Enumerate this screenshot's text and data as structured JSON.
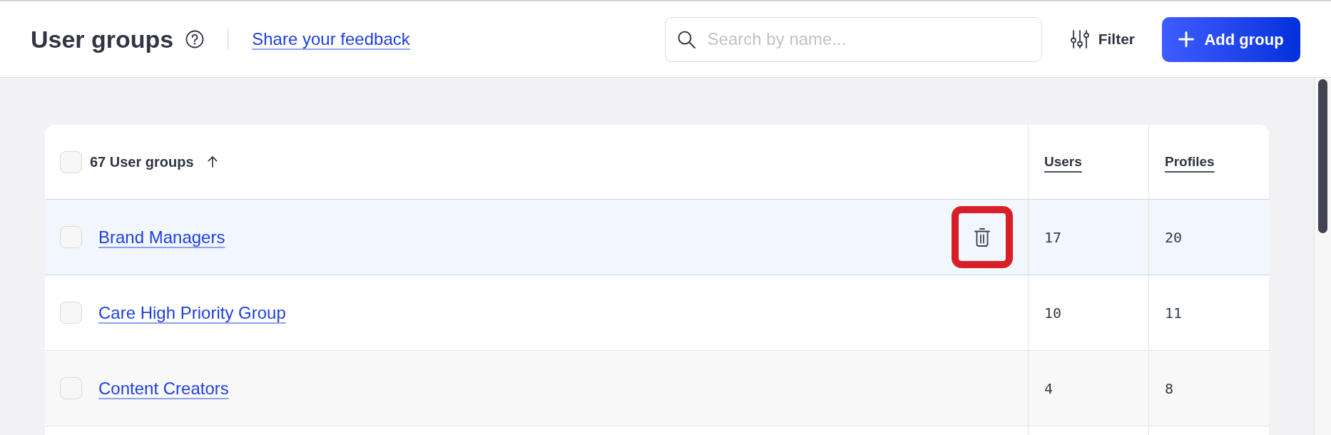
{
  "header": {
    "title": "User groups",
    "feedback_link": "Share your feedback",
    "search": {
      "placeholder": "Search by name..."
    },
    "filter_button": "Filter",
    "add_button": "Add group"
  },
  "table": {
    "all_checked": false,
    "columns": [
      {
        "label": "67 User groups",
        "sort_ascending": true
      },
      {
        "label": "Users"
      },
      {
        "label": "Profiles"
      }
    ],
    "rows": [
      {
        "name": "Brand Managers",
        "users": "17",
        "profiles": "20",
        "checked": false,
        "hovered": true,
        "delete_highlighted": true
      },
      {
        "name": "Care High Priority Group",
        "users": "10",
        "profiles": "11",
        "checked": false,
        "hovered": false,
        "delete_highlighted": false
      },
      {
        "name": "Content Creators",
        "users": "4",
        "profiles": "8",
        "checked": false,
        "hovered": false,
        "delete_highlighted": false
      }
    ]
  }
}
